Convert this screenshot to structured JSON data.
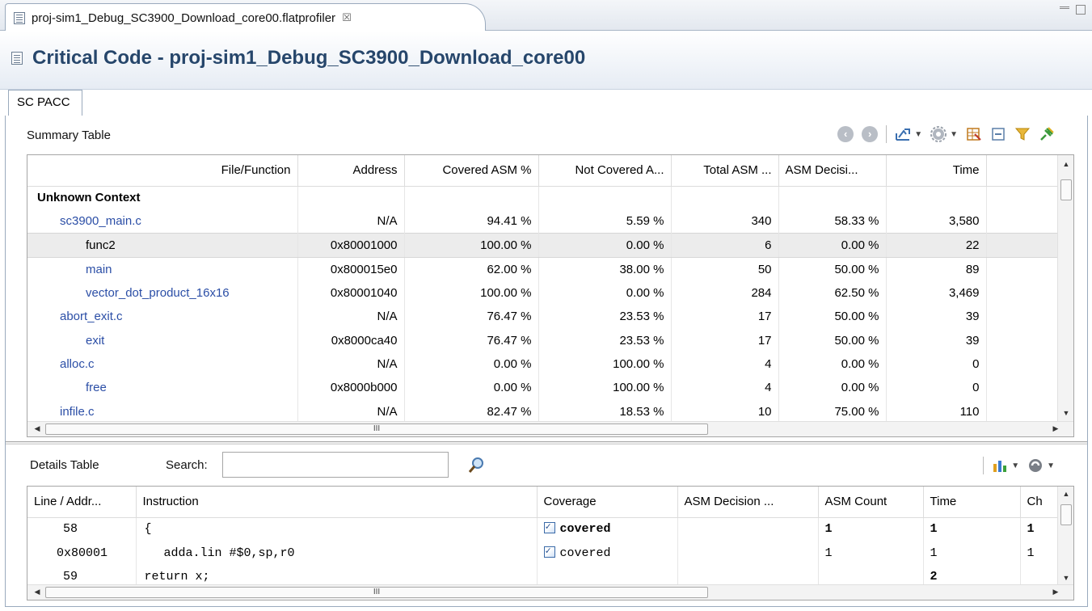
{
  "editor_tab": {
    "title": "proj-sim1_Debug_SC3900_Download_core00.flatprofiler",
    "close_glyph": "☒"
  },
  "form": {
    "title": "Critical Code - proj-sim1_Debug_SC3900_Download_core00"
  },
  "subtabs": [
    {
      "label": "SC PACC"
    }
  ],
  "summary": {
    "label": "Summary Table",
    "toolbar_icons": [
      "back-icon",
      "forward-icon",
      "export-icon",
      "settings-icon",
      "configure-columns-icon",
      "collapse-all-icon",
      "filter-icon",
      "pin-icon"
    ],
    "columns": [
      "File/Function",
      "Address",
      "Covered ASM %",
      "Not Covered A...",
      "Total ASM ...",
      "ASM Decisi...",
      "Time"
    ],
    "rows": [
      {
        "cells": [
          "Unknown Context",
          "",
          "",
          "",
          "",
          "",
          ""
        ],
        "level": 0,
        "style": "bold"
      },
      {
        "cells": [
          "sc3900_main.c",
          "N/A",
          "94.41 %",
          "5.59 %",
          "340",
          "58.33 %",
          "3,580"
        ],
        "level": 1,
        "style": "link"
      },
      {
        "cells": [
          "func2",
          "0x80001000",
          "100.00 %",
          "0.00 %",
          "6",
          "0.00 %",
          "22"
        ],
        "level": 2,
        "style": "plain",
        "selected": true
      },
      {
        "cells": [
          "main",
          "0x800015e0",
          "62.00 %",
          "38.00 %",
          "50",
          "50.00 %",
          "89"
        ],
        "level": 2,
        "style": "link"
      },
      {
        "cells": [
          "vector_dot_product_16x16",
          "0x80001040",
          "100.00 %",
          "0.00 %",
          "284",
          "62.50 %",
          "3,469"
        ],
        "level": 2,
        "style": "link"
      },
      {
        "cells": [
          "abort_exit.c",
          "N/A",
          "76.47 %",
          "23.53 %",
          "17",
          "50.00 %",
          "39"
        ],
        "level": 1,
        "style": "link"
      },
      {
        "cells": [
          "exit",
          "0x8000ca40",
          "76.47 %",
          "23.53 %",
          "17",
          "50.00 %",
          "39"
        ],
        "level": 2,
        "style": "link"
      },
      {
        "cells": [
          "alloc.c",
          "N/A",
          "0.00 %",
          "100.00 %",
          "4",
          "0.00 %",
          "0"
        ],
        "level": 1,
        "style": "link"
      },
      {
        "cells": [
          "free",
          "0x8000b000",
          "0.00 %",
          "100.00 %",
          "4",
          "0.00 %",
          "0"
        ],
        "level": 2,
        "style": "link"
      },
      {
        "cells": [
          "infile.c",
          "N/A",
          "82.47 %",
          "18.53 %",
          "10",
          "75.00 %",
          "110"
        ],
        "level": 1,
        "style": "link"
      }
    ],
    "hscroll_grip": "III"
  },
  "details": {
    "label": "Details Table",
    "search_label": "Search:",
    "search_value": "",
    "columns": [
      "Line / Addr...",
      "Instruction",
      "Coverage",
      "ASM Decision ...",
      "ASM Count",
      "Time",
      "Ch"
    ],
    "rows": [
      {
        "cells": [
          "58",
          "{",
          "covered",
          "",
          "1",
          "1",
          "1"
        ],
        "type": "source"
      },
      {
        "cells": [
          "0x80001",
          "adda.lin #$0,sp,r0",
          "covered",
          "",
          "1",
          "1",
          "1"
        ],
        "type": "asm"
      },
      {
        "cells": [
          "59",
          "return x;",
          "",
          "",
          "",
          "2",
          ""
        ],
        "type": "source"
      }
    ],
    "hscroll_grip": "III"
  }
}
